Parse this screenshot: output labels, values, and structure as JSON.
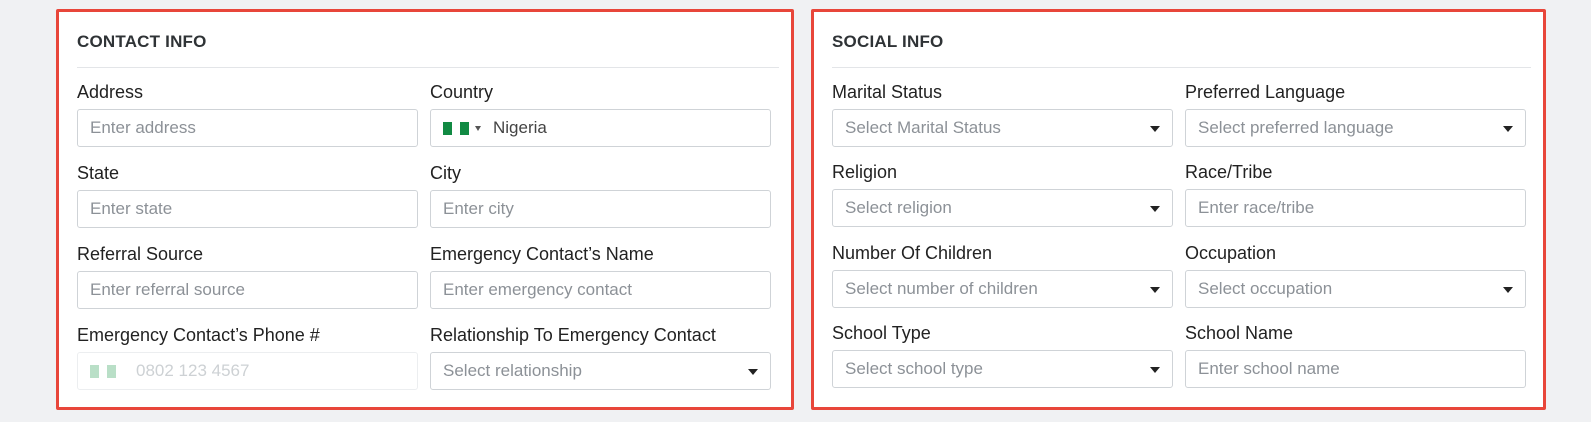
{
  "contact": {
    "title": "CONTACT INFO",
    "address": {
      "label": "Address",
      "placeholder": "Enter address"
    },
    "country": {
      "label": "Country",
      "value": "Nigeria"
    },
    "state": {
      "label": "State",
      "placeholder": "Enter state"
    },
    "city": {
      "label": "City",
      "placeholder": "Enter city"
    },
    "referral": {
      "label": "Referral Source",
      "placeholder": "Enter referral source"
    },
    "emergency_name": {
      "label": "Emergency Contact’s Name",
      "placeholder": "Enter emergency contact"
    },
    "emergency_phone": {
      "label": "Emergency Contact’s Phone #",
      "placeholder": "0802 123 4567"
    },
    "relationship": {
      "label": "Relationship To Emergency Contact",
      "placeholder": "Select relationship"
    }
  },
  "social": {
    "title": "SOCIAL INFO",
    "marital": {
      "label": "Marital Status",
      "placeholder": "Select Marital Status"
    },
    "language": {
      "label": "Preferred Language",
      "placeholder": "Select preferred language"
    },
    "religion": {
      "label": "Religion",
      "placeholder": "Select religion"
    },
    "race": {
      "label": "Race/Tribe",
      "placeholder": "Enter race/tribe"
    },
    "children": {
      "label": "Number Of Children",
      "placeholder": "Select number of children"
    },
    "occupation": {
      "label": "Occupation",
      "placeholder": "Select occupation"
    },
    "school_type": {
      "label": "School Type",
      "placeholder": "Select school type"
    },
    "school_name": {
      "label": "School Name",
      "placeholder": "Enter school name"
    }
  },
  "colors": {
    "highlight_border": "#e8463a",
    "flag_green": "#118a43"
  }
}
